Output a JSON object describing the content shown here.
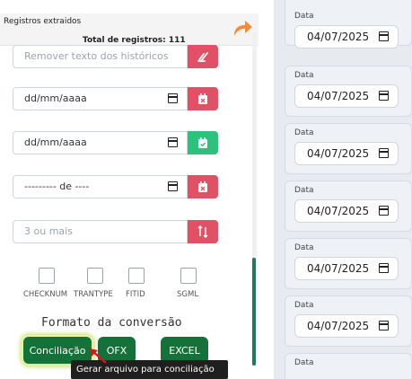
{
  "panel": {
    "title": "Registros extraidos",
    "total": "Total de registros: 111"
  },
  "filters": {
    "remove_text_placeholder": "Remover texto dos históricos",
    "date_from": "dd/mm/aaaa",
    "date_to": "dd/mm/aaaa",
    "month_field": "--------- de ----",
    "min_count_placeholder": "3 ou mais"
  },
  "checkboxes": [
    {
      "label": "CHECKNUM"
    },
    {
      "label": "TRANTYPE"
    },
    {
      "label": "FITID"
    },
    {
      "label": "SGML"
    }
  ],
  "format": {
    "title": "Formato da conversão",
    "buttons": [
      "Conciliação",
      "OFX",
      "EXCEL"
    ]
  },
  "tooltip": "Gerar arquivo para conciliação",
  "date_cards": [
    {
      "label": "Data",
      "value": "04/07/2025"
    },
    {
      "label": "Data",
      "value": "04/07/2025"
    },
    {
      "label": "Data",
      "value": "04/07/2025"
    },
    {
      "label": "Data",
      "value": "04/07/2025"
    },
    {
      "label": "Data",
      "value": "04/07/2025"
    },
    {
      "label": "Data",
      "value": "04/07/2025"
    },
    {
      "label": "Data",
      "value": ""
    }
  ],
  "colors": {
    "danger": "#e05165",
    "success": "#2fc07e",
    "button": "#15713a",
    "share": "#f28c38"
  },
  "icons": [
    "share-arrow-icon",
    "eraser-icon",
    "calendar-x-icon",
    "calendar-check-icon",
    "sort-numeric-icon",
    "calendar-icon"
  ]
}
